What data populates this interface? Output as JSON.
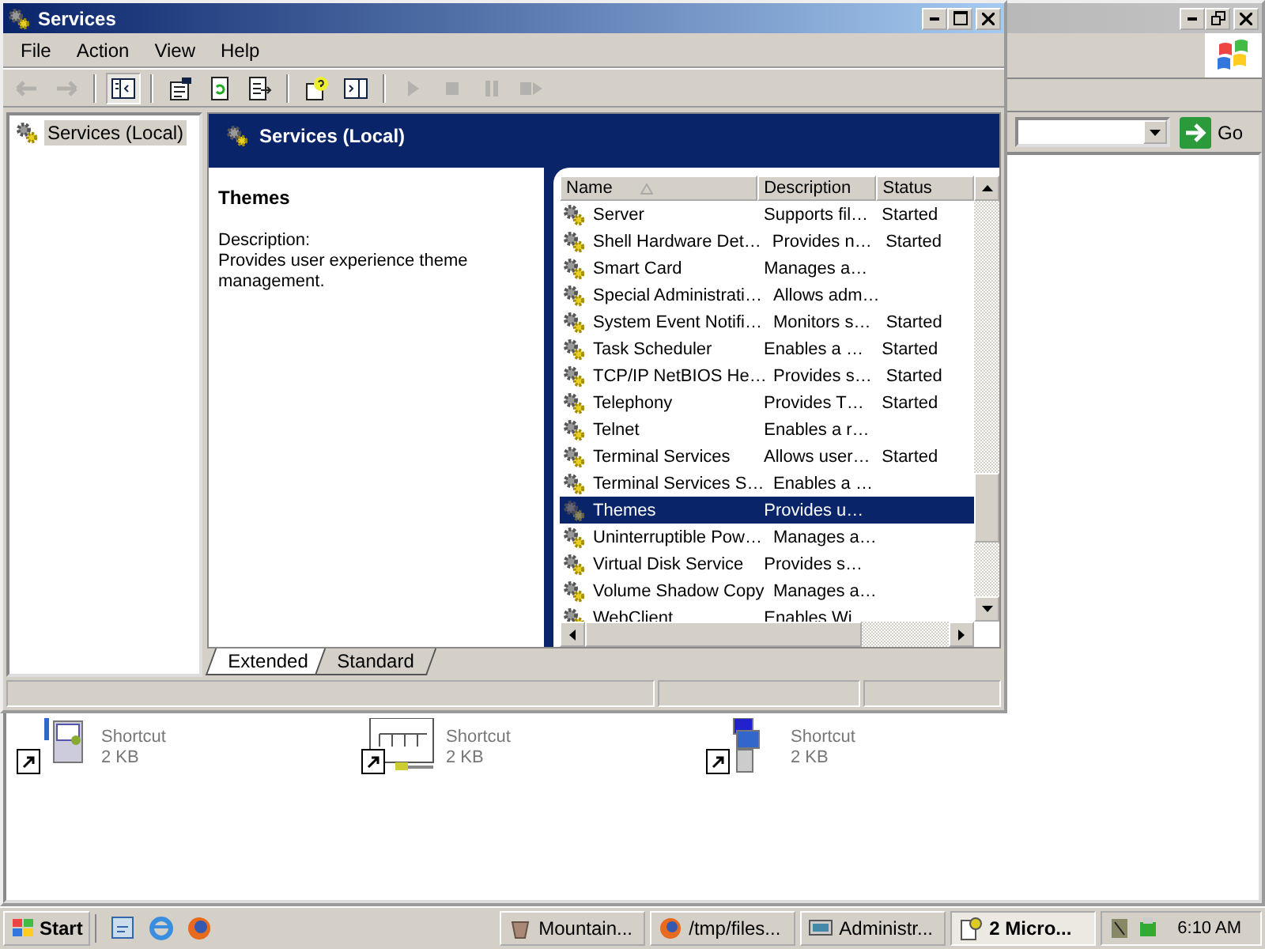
{
  "background_window": {
    "go_button": "Go",
    "shortcuts": [
      {
        "type": "Shortcut",
        "size": "2 KB"
      },
      {
        "type": "Shortcut",
        "size": "2 KB"
      },
      {
        "type": "Shortcut",
        "size": "2 KB"
      }
    ]
  },
  "window": {
    "title": "Services"
  },
  "menu": [
    "File",
    "Action",
    "View",
    "Help"
  ],
  "toolbar": [
    {
      "disabled": true
    },
    {
      "disabled": true
    },
    {
      "disabled": false
    },
    {
      "disabled": false
    },
    {
      "disabled": false
    },
    {
      "disabled": false
    },
    {
      "disabled": false
    },
    {
      "disabled": false
    },
    {
      "disabled": true
    },
    {
      "disabled": true
    },
    {
      "disabled": true
    },
    {
      "disabled": true
    }
  ],
  "tree": [
    {
      "label": "Services (Local)",
      "selected": true
    }
  ],
  "header": "Services (Local)",
  "details": {
    "title": "Themes",
    "label": "Description:",
    "text": "Provides user experience theme management."
  },
  "table": {
    "columns": [
      "Name",
      "Description",
      "Status"
    ],
    "rows": [
      {
        "name": "Server",
        "description": "Supports fil…",
        "status": "Started",
        "selected": false
      },
      {
        "name": "Shell Hardware Det…",
        "description": "Provides n…",
        "status": "Started",
        "selected": false
      },
      {
        "name": "Smart Card",
        "description": "Manages a…",
        "status": "",
        "selected": false
      },
      {
        "name": "Special Administrati…",
        "description": "Allows adm…",
        "status": "",
        "selected": false
      },
      {
        "name": "System Event Notifi…",
        "description": "Monitors s…",
        "status": "Started",
        "selected": false
      },
      {
        "name": "Task Scheduler",
        "description": "Enables a …",
        "status": "Started",
        "selected": false
      },
      {
        "name": "TCP/IP NetBIOS He…",
        "description": "Provides s…",
        "status": "Started",
        "selected": false
      },
      {
        "name": "Telephony",
        "description": "Provides T…",
        "status": "Started",
        "selected": false
      },
      {
        "name": "Telnet",
        "description": "Enables a r…",
        "status": "",
        "selected": false
      },
      {
        "name": "Terminal Services",
        "description": "Allows user…",
        "status": "Started",
        "selected": false
      },
      {
        "name": "Terminal Services S…",
        "description": "Enables a …",
        "status": "",
        "selected": false
      },
      {
        "name": "Themes",
        "description": "Provides u…",
        "status": "",
        "selected": true
      },
      {
        "name": "Uninterruptible Pow…",
        "description": "Manages a…",
        "status": "",
        "selected": false
      },
      {
        "name": "Virtual Disk Service",
        "description": "Provides s…",
        "status": "",
        "selected": false
      },
      {
        "name": "Volume Shadow Copy",
        "description": "Manages a…",
        "status": "",
        "selected": false
      },
      {
        "name": "WebClient",
        "description": "Enables Wi",
        "status": "",
        "selected": false
      }
    ]
  },
  "view_tabs": [
    {
      "label": "Extended",
      "selected": true
    },
    {
      "label": "Standard",
      "selected": false
    }
  ],
  "taskbar": {
    "start": "Start",
    "tasks": [
      {
        "label": "Mountain...",
        "selected": false
      },
      {
        "label": "/tmp/files...",
        "selected": false
      },
      {
        "label": "Administr...",
        "selected": false
      },
      {
        "label": "2 Micro...",
        "selected": true
      }
    ],
    "clock": "6:10 AM"
  }
}
